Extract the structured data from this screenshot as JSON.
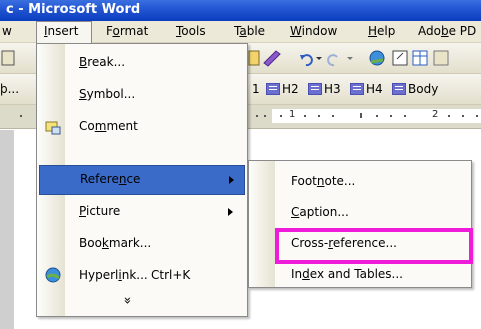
{
  "window": {
    "title": "c - Microsoft Word"
  },
  "menubar": {
    "items": [
      {
        "pre": "",
        "key": "",
        "post": "w"
      },
      {
        "pre": "",
        "key": "I",
        "post": "nsert"
      },
      {
        "pre": "F",
        "key": "o",
        "post": "rmat"
      },
      {
        "pre": "",
        "key": "T",
        "post": "ools"
      },
      {
        "pre": "T",
        "key": "a",
        "post": "ble"
      },
      {
        "pre": "",
        "key": "W",
        "post": "indow"
      },
      {
        "pre": "",
        "key": "H",
        "post": "elp"
      },
      {
        "pre": "Ado",
        "key": "b",
        "post": "e PD"
      }
    ]
  },
  "toolbar2": {
    "left_text": "þ...",
    "styles": [
      "1",
      "H2",
      "H3",
      "H4",
      "Body"
    ]
  },
  "ruler": {
    "marks": [
      "1",
      "2"
    ]
  },
  "insert_menu": {
    "items": [
      {
        "pre": "",
        "key": "B",
        "post": "reak...",
        "shortcut": "",
        "submenu": false
      },
      {
        "pre": "",
        "key": "S",
        "post": "ymbol...",
        "shortcut": "",
        "submenu": false
      },
      {
        "pre": "Co",
        "key": "m",
        "post": "ment",
        "shortcut": "",
        "submenu": false
      },
      {
        "pre": "Refere",
        "key": "n",
        "post": "ce",
        "shortcut": "",
        "submenu": true
      },
      {
        "pre": "",
        "key": "P",
        "post": "icture",
        "shortcut": "",
        "submenu": true
      },
      {
        "pre": "Boo",
        "key": "k",
        "post": "mark...",
        "shortcut": "",
        "submenu": false
      },
      {
        "pre": "Hyperl",
        "key": "i",
        "post": "nk...",
        "shortcut": "Ctrl+K",
        "submenu": false
      }
    ],
    "expand_chevron": "»"
  },
  "reference_submenu": {
    "items": [
      {
        "pre": "Foot",
        "key": "n",
        "post": "ote..."
      },
      {
        "pre": "",
        "key": "C",
        "post": "aption..."
      },
      {
        "pre": "Cross-",
        "key": "r",
        "post": "eference..."
      },
      {
        "pre": "In",
        "key": "d",
        "post": "ex and Tables..."
      }
    ]
  },
  "colors": {
    "highlight": "#ee1bd8",
    "selection": "#3a6bc8",
    "titlebar": "#2457d4"
  }
}
